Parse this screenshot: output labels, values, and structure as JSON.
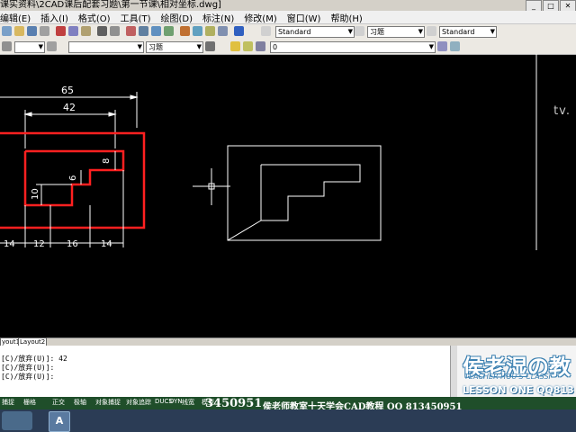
{
  "window": {
    "title": "课实资料\\2CAD课后配套习题\\第一节课\\相对坐标.dwg]",
    "buttons": [
      "_",
      "□",
      "✕"
    ]
  },
  "menu": [
    "编辑(E)",
    "插入(I)",
    "格式(O)",
    "工具(T)",
    "绘图(D)",
    "标注(N)",
    "修改(M)",
    "窗口(W)",
    "帮助(H)"
  ],
  "toolbar": {
    "text_style": "Standard",
    "dim_style": "习题",
    "table_style": "Standard",
    "layer_combo": "习题",
    "layer_value": "0"
  },
  "drawing": {
    "dims": [
      "65",
      "42",
      "8",
      "6",
      "10",
      "14",
      "12",
      "16",
      "14"
    ],
    "corner_text": "tv."
  },
  "tabs": [
    "yout1",
    "Layout2"
  ],
  "command": {
    "lines": [
      "[C)/放弃(U)]: 42",
      "[C)/放弃(U)]:",
      "[C)/放弃(U)]:"
    ]
  },
  "watermark": {
    "title": "侯老湿の教",
    "subtitle": "TEACHER HOU'S CLASSI",
    "lesson": "LESSON ONE QQ813"
  },
  "status": {
    "segments": [
      "捕捉",
      "栅格",
      "正交",
      "极轴",
      "对象捕捉",
      "对象追踪",
      "DUCS",
      "DYN",
      "线宽",
      "模型"
    ],
    "overlay_qq": "3450951",
    "overlay_text": "侯老师教室十天学会CAD教程 QQ 813450951"
  },
  "taskbar": {
    "app_icon": "A",
    "clock": ""
  }
}
